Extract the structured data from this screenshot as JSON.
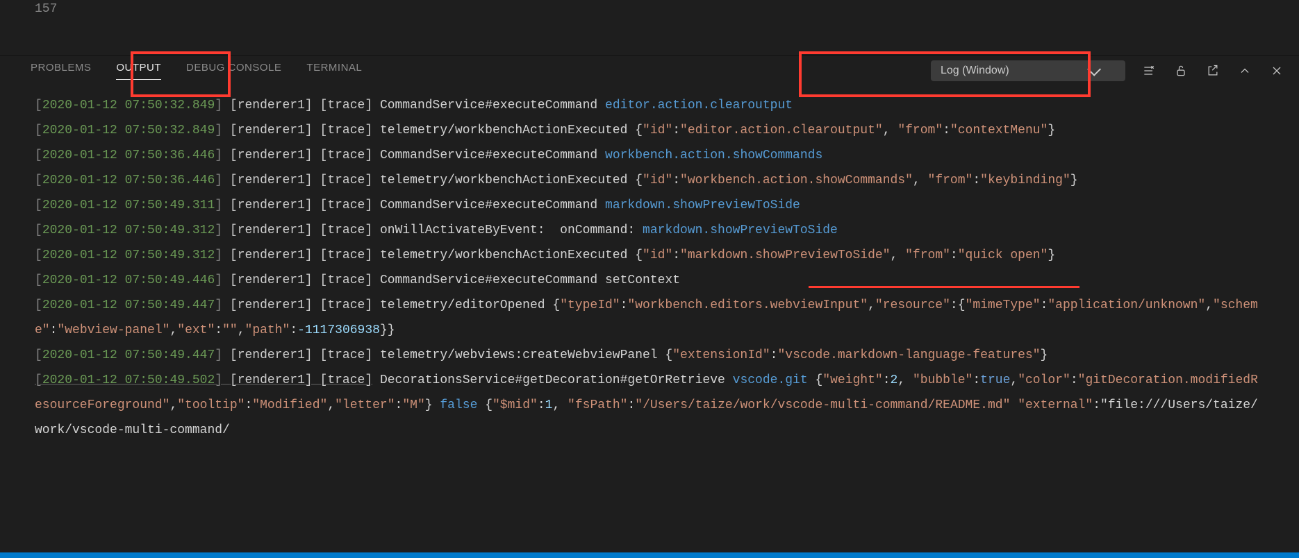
{
  "editor": {
    "line_number": "157"
  },
  "panel": {
    "tabs": {
      "problems": "PROBLEMS",
      "output": "OUTPUT",
      "debug_console": "DEBUG CONSOLE",
      "terminal": "TERMINAL"
    },
    "channel_selector": "Log (Window)"
  },
  "log": [
    {
      "ts": "2020-01-12 07:50:32.849",
      "src": "[renderer1] [trace]",
      "msg": "CommandService#executeCommand",
      "hl": "editor.action.clearoutput"
    },
    {
      "ts": "2020-01-12 07:50:32.849",
      "src": "[renderer1] [trace]",
      "msg": "telemetry/workbenchActionExecuted",
      "json": "{\"id\":\"editor.action.clearoutput\", \"from\":\"contextMenu\"}"
    },
    {
      "ts": "2020-01-12 07:50:36.446",
      "src": "[renderer1] [trace]",
      "msg": "CommandService#executeCommand",
      "hl": "workbench.action.showCommands"
    },
    {
      "ts": "2020-01-12 07:50:36.446",
      "src": "[renderer1] [trace]",
      "msg": "telemetry/workbenchActionExecuted",
      "json": "{\"id\":\"workbench.action.showCommands\", \"from\":\"keybinding\"}"
    },
    {
      "ts": "2020-01-12 07:50:49.311",
      "src": "[renderer1] [trace]",
      "msg": "CommandService#executeCommand",
      "hl": "markdown.showPreviewToSide"
    },
    {
      "ts": "2020-01-12 07:50:49.312",
      "src": "[renderer1] [trace]",
      "msg": "onWillActivateByEvent:  onCommand:",
      "hl": "markdown.showPreviewToSide"
    },
    {
      "ts": "2020-01-12 07:50:49.312",
      "src": "[renderer1] [trace]",
      "msg": "telemetry/workbenchActionExecuted",
      "json": "{\"id\":\"markdown.showPreviewToSide\", \"from\":\"quick open\"}"
    },
    {
      "ts": "2020-01-12 07:50:49.446",
      "src": "[renderer1] [trace]",
      "msg": "CommandService#executeCommand setContext"
    },
    {
      "ts": "2020-01-12 07:50:49.447",
      "src": "[renderer1] [trace]",
      "msg": "telemetry/editorOpened",
      "json": "{\"typeId\":\"workbench.editors.webviewInput\",\"resource\":{\"mimeType\":\"application/unknown\",\"scheme\":\"webview-panel\",\"ext\":\"\",\"path\":-1117306938}}"
    },
    {
      "ts": "2020-01-12 07:50:49.447",
      "src": "[renderer1] [trace]",
      "msg": "telemetry/webviews:createWebviewPanel",
      "json": "{\"extensionId\":\"vscode.markdown-language-features\"}"
    },
    {
      "ts": "2020-01-12 07:50:49.502",
      "src": "[renderer1] [trace]",
      "msg": "DecorationsService#getDecoration#getOrRetrieve",
      "hl": "vscode.git",
      "json2": "{\"weight\":2, \"bubble\":true,\"color\":\"gitDecoration.modifiedResourceForeground\",\"tooltip\":\"Modified\",\"letter\":\"M\"}",
      "hl2": "false",
      "json3": "{\"$mid\":1, \"fsPath\":\"/Users/taize/work/vscode-multi-command/README.md\" \"external\":\"file:///Users/taize/work/vscode-multi-command/",
      "underline": true
    }
  ]
}
